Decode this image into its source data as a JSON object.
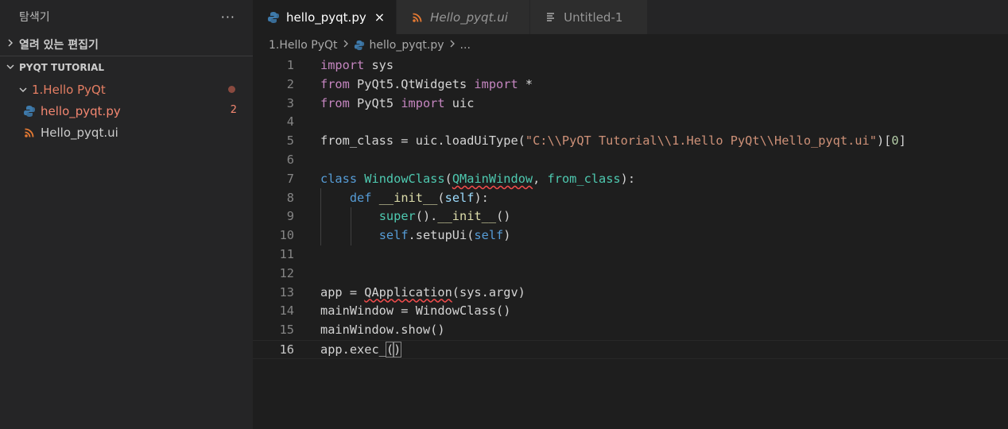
{
  "sidebar": {
    "title": "탐색기",
    "more": "···",
    "open_editors": "열려 있는 편집기",
    "project": "PYQT TUTORIAL",
    "folder": "1.Hello PyQt",
    "files": [
      {
        "name": "hello_pyqt.py",
        "badge": "2"
      },
      {
        "name": "Hello_pyqt.ui",
        "badge": ""
      }
    ]
  },
  "tabs": [
    {
      "label": "hello_pyqt.py",
      "close": "×"
    },
    {
      "label": "Hello_pyqt.ui"
    },
    {
      "label": "Untitled-1"
    }
  ],
  "breadcrumb": [
    "1.Hello PyQt",
    "hello_pyqt.py",
    "..."
  ],
  "code": {
    "line_numbers": [
      "1",
      "2",
      "3",
      "4",
      "5",
      "6",
      "7",
      "8",
      "9",
      "10",
      "11",
      "12",
      "13",
      "14",
      "15",
      "16"
    ],
    "lines": [
      "import sys",
      "from PyQt5.QtWidgets import *",
      "from PyQt5 import uic",
      "",
      "from_class = uic.loadUiType(\"C:\\\\PyQT Tutorial\\\\1.Hello PyQt\\\\Hello_pyqt.ui\")[0]",
      "",
      "class WindowClass(QMainWindow, from_class):",
      "    def __init__(self):",
      "        super().__init__()",
      "        self.setupUi(self)",
      "",
      "",
      "app = QApplication(sys.argv)",
      "mainWindow = WindowClass()",
      "mainWindow.show()",
      "app.exec_()"
    ]
  },
  "colors": {
    "keyword": "#c586c0",
    "storage": "#569cd6",
    "class": "#4ec9b0",
    "function": "#dcdcaa",
    "string": "#ce9178",
    "number": "#b5cea8",
    "variable": "#9cdcfe",
    "error": "#f48771"
  }
}
